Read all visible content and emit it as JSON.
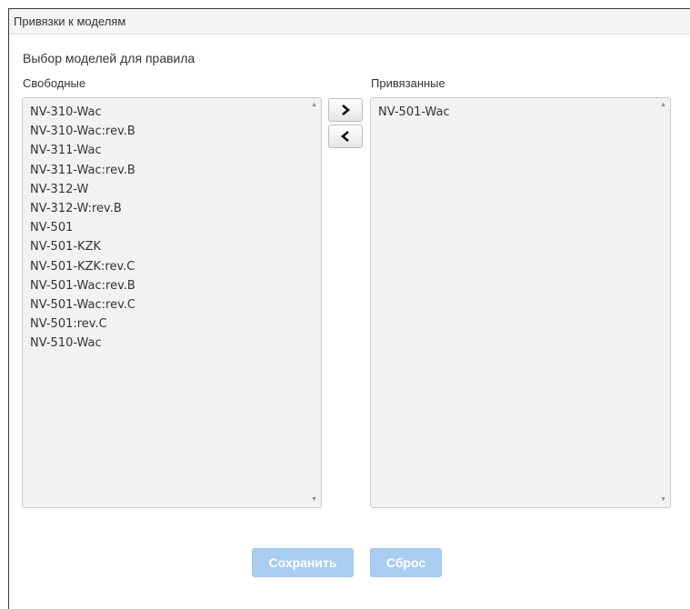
{
  "header": {
    "title": "Привязки к моделям"
  },
  "section": {
    "title": "Выбор моделей для правила"
  },
  "free_list": {
    "label": "Свободные",
    "items": [
      "NV-310-Wac",
      "NV-310-Wac:rev.B",
      "NV-311-Wac",
      "NV-311-Wac:rev.B",
      "NV-312-W",
      "NV-312-W:rev.B",
      "NV-501",
      "NV-501-KZK",
      "NV-501-KZK:rev.C",
      "NV-501-Wac:rev.B",
      "NV-501-Wac:rev.C",
      "NV-501:rev.C",
      "NV-510-Wac"
    ]
  },
  "bound_list": {
    "label": "Привязанные",
    "items": [
      "NV-501-Wac"
    ]
  },
  "move_buttons": {
    "add_icon": "chevron-right-icon",
    "remove_icon": "chevron-left-icon"
  },
  "actions": {
    "save_label": "Сохранить",
    "reset_label": "Сброс"
  },
  "colors": {
    "primary_disabled": "#a9cdf0",
    "listbox_bg": "#f2f2f2",
    "header_bg": "#f5f5f5",
    "text": "#333333"
  }
}
